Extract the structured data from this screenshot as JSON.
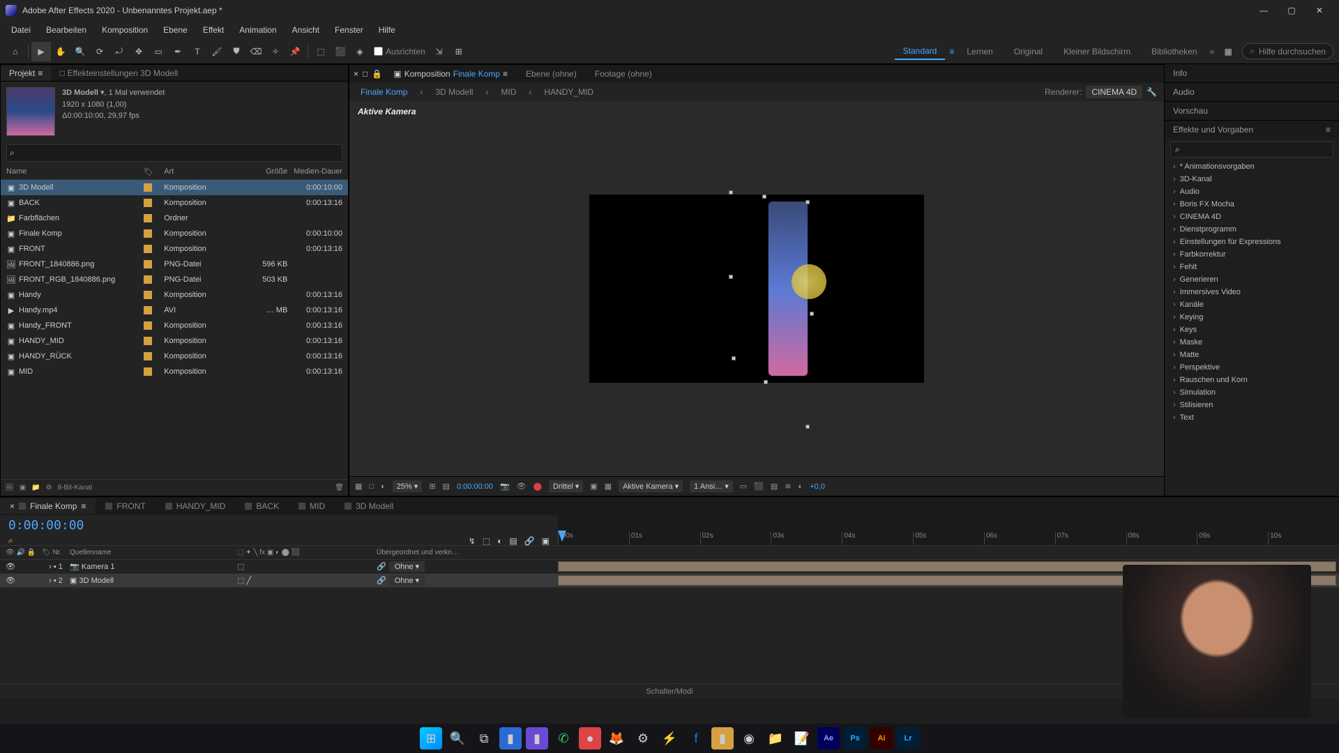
{
  "window": {
    "title": "Adobe After Effects 2020 - Unbenanntes Projekt.aep *"
  },
  "menu": [
    "Datei",
    "Bearbeiten",
    "Komposition",
    "Ebene",
    "Effekt",
    "Animation",
    "Ansicht",
    "Fenster",
    "Hilfe"
  ],
  "toolbar": {
    "align_label": "Ausrichten",
    "workspaces": [
      "Standard",
      "Lernen",
      "Original",
      "Kleiner Bildschirm",
      "Bibliotheken"
    ],
    "search_placeholder": "Hilfe durchsuchen"
  },
  "project_panel": {
    "tab_project": "Projekt",
    "tab_effect": "Effekteinstellungen 3D Modell",
    "sel_name": "3D Modell",
    "sel_usage": ", 1 Mal verwendet",
    "sel_dims": "1920 x 1080 (1,00)",
    "sel_dur": "Δ0:00:10:00, 29,97 fps",
    "cols": {
      "name": "Name",
      "label": "",
      "type": "Art",
      "size": "Größe",
      "dur": "Medien-Dauer"
    },
    "items": [
      {
        "name": "3D Modell",
        "icon": "comp",
        "type": "Komposition",
        "size": "",
        "dur": "0:00:10:00",
        "sel": true
      },
      {
        "name": "BACK",
        "icon": "comp",
        "type": "Komposition",
        "size": "",
        "dur": "0:00:13:16"
      },
      {
        "name": "Farbflächen",
        "icon": "folder",
        "type": "Ordner",
        "size": "",
        "dur": ""
      },
      {
        "name": "Finale Komp",
        "icon": "comp",
        "type": "Komposition",
        "size": "",
        "dur": "0:00:10:00"
      },
      {
        "name": "FRONT",
        "icon": "comp",
        "type": "Komposition",
        "size": "",
        "dur": "0:00:13:16"
      },
      {
        "name": "FRONT_1840886.png",
        "icon": "img",
        "type": "PNG-Datei",
        "size": "596 KB",
        "dur": ""
      },
      {
        "name": "FRONT_RGB_1840886.png",
        "icon": "img",
        "type": "PNG-Datei",
        "size": "503 KB",
        "dur": ""
      },
      {
        "name": "Handy",
        "icon": "comp",
        "type": "Komposition",
        "size": "",
        "dur": "0:00:13:16"
      },
      {
        "name": "Handy.mp4",
        "icon": "vid",
        "type": "AVI",
        "size": "… MB",
        "dur": "0:00:13:16"
      },
      {
        "name": "Handy_FRONT",
        "icon": "comp",
        "type": "Komposition",
        "size": "",
        "dur": "0:00:13:16"
      },
      {
        "name": "HANDY_MID",
        "icon": "comp",
        "type": "Komposition",
        "size": "",
        "dur": "0:00:13:16"
      },
      {
        "name": "HANDY_RÜCK",
        "icon": "comp",
        "type": "Komposition",
        "size": "",
        "dur": "0:00:13:16"
      },
      {
        "name": "MID",
        "icon": "comp",
        "type": "Komposition",
        "size": "",
        "dur": "0:00:13:16"
      }
    ],
    "bit_depth": "8-Bit-Kanal"
  },
  "comp_panel": {
    "tab_comp_prefix": "Komposition",
    "tab_comp_name": "Finale Komp",
    "tab_layer": "Ebene  (ohne)",
    "tab_footage": "Footage  (ohne)",
    "crumbs": [
      "Finale Komp",
      "3D Modell",
      "MID",
      "HANDY_MID"
    ],
    "renderer_label": "Renderer:",
    "renderer_value": "CINEMA 4D",
    "viewer_label": "Aktive Kamera",
    "footer": {
      "zoom": "25%",
      "timecode": "0:00:00:00",
      "res": "Drittel",
      "cam": "Aktive Kamera",
      "views": "1 Ansi…",
      "exposure": "+0,0"
    }
  },
  "right_panels": {
    "info": "Info",
    "audio": "Audio",
    "preview": "Vorschau",
    "fx_title": "Effekte und Vorgaben",
    "fx_items": [
      "* Animationsvorgaben",
      "3D-Kanal",
      "Audio",
      "Boris FX Mocha",
      "CINEMA 4D",
      "Dienstprogramm",
      "Einstellungen für Expressions",
      "Farbkorrektur",
      "Fehlt",
      "Generieren",
      "Immersives Video",
      "Kanäle",
      "Keying",
      "Keys",
      "Maske",
      "Matte",
      "Perspektive",
      "Rauschen und Korn",
      "Simulation",
      "Stilisieren",
      "Text"
    ]
  },
  "timeline": {
    "tabs": [
      "Finale Komp",
      "FRONT",
      "HANDY_MID",
      "BACK",
      "MID",
      "3D Modell"
    ],
    "timecode": "0:00:00:00",
    "cols": {
      "nr": "Nr.",
      "name": "Quellenname",
      "parent": "Übergeordnet und verkn…"
    },
    "parent_none": "Ohne",
    "layers": [
      {
        "nr": "1",
        "name": "Kamera 1",
        "icon": "cam"
      },
      {
        "nr": "2",
        "name": "3D Modell",
        "icon": "comp",
        "sel": true
      }
    ],
    "ruler": [
      ":00s",
      "01s",
      "02s",
      "03s",
      "04s",
      "05s",
      "06s",
      "07s",
      "08s",
      "09s",
      "10s"
    ],
    "footer": "Schalter/Modi"
  }
}
